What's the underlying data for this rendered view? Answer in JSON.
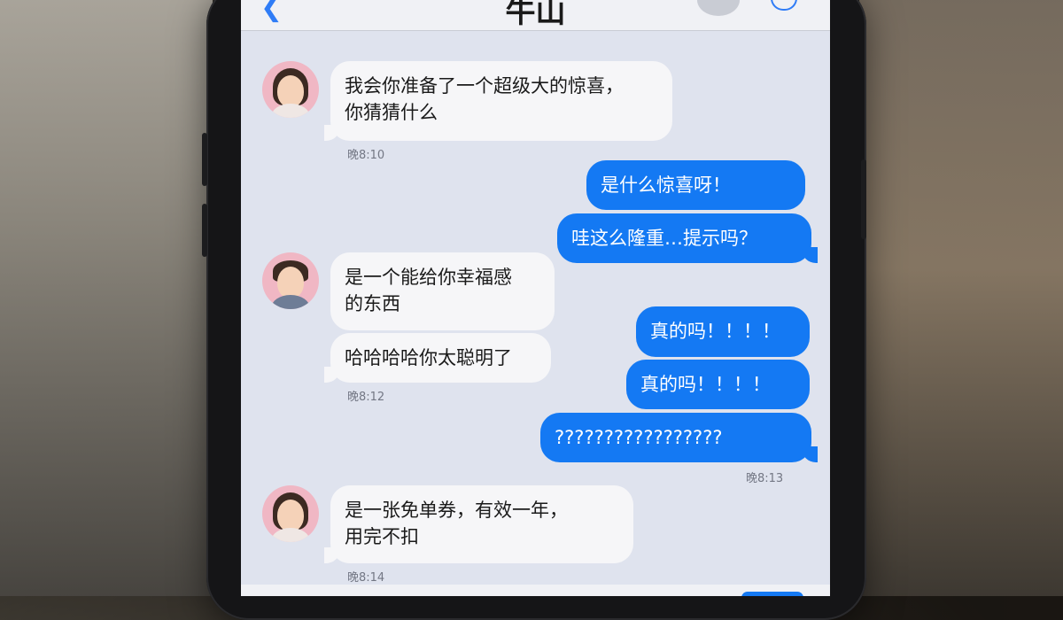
{
  "header": {
    "title": "牛山",
    "back_icon": "chevron-left-icon",
    "call_icon": "phone-icon"
  },
  "messages": [
    {
      "side": "in",
      "text": "我会你准备了一个超级大的惊喜，\n你猜猜什么"
    },
    {
      "side": "ts",
      "text": "晚8:10"
    },
    {
      "side": "out",
      "text": "是什么惊喜呀！"
    },
    {
      "side": "out",
      "text": "哇这么隆重…提示吗？"
    },
    {
      "side": "in",
      "text": "是一个能给你幸福感\n的东西"
    },
    {
      "side": "in",
      "text": "哈哈哈哈你太聪明了"
    },
    {
      "side": "ts",
      "text": "晚8:12"
    },
    {
      "side": "out",
      "text": "真的吗！！！！"
    },
    {
      "side": "out",
      "text": "真的吗！！！！"
    },
    {
      "side": "out",
      "text": "?????????????????"
    },
    {
      "side": "ts",
      "text": "晚8:13"
    },
    {
      "side": "in",
      "text": "是一张免单券，有效一年，\n用完不扣"
    },
    {
      "side": "ts",
      "text": "晚8:14"
    }
  ],
  "colors": {
    "incoming_bubble": "#f6f6f8",
    "outgoing_bubble": "#1479f3",
    "screen_bg": "#dfe3ee"
  }
}
